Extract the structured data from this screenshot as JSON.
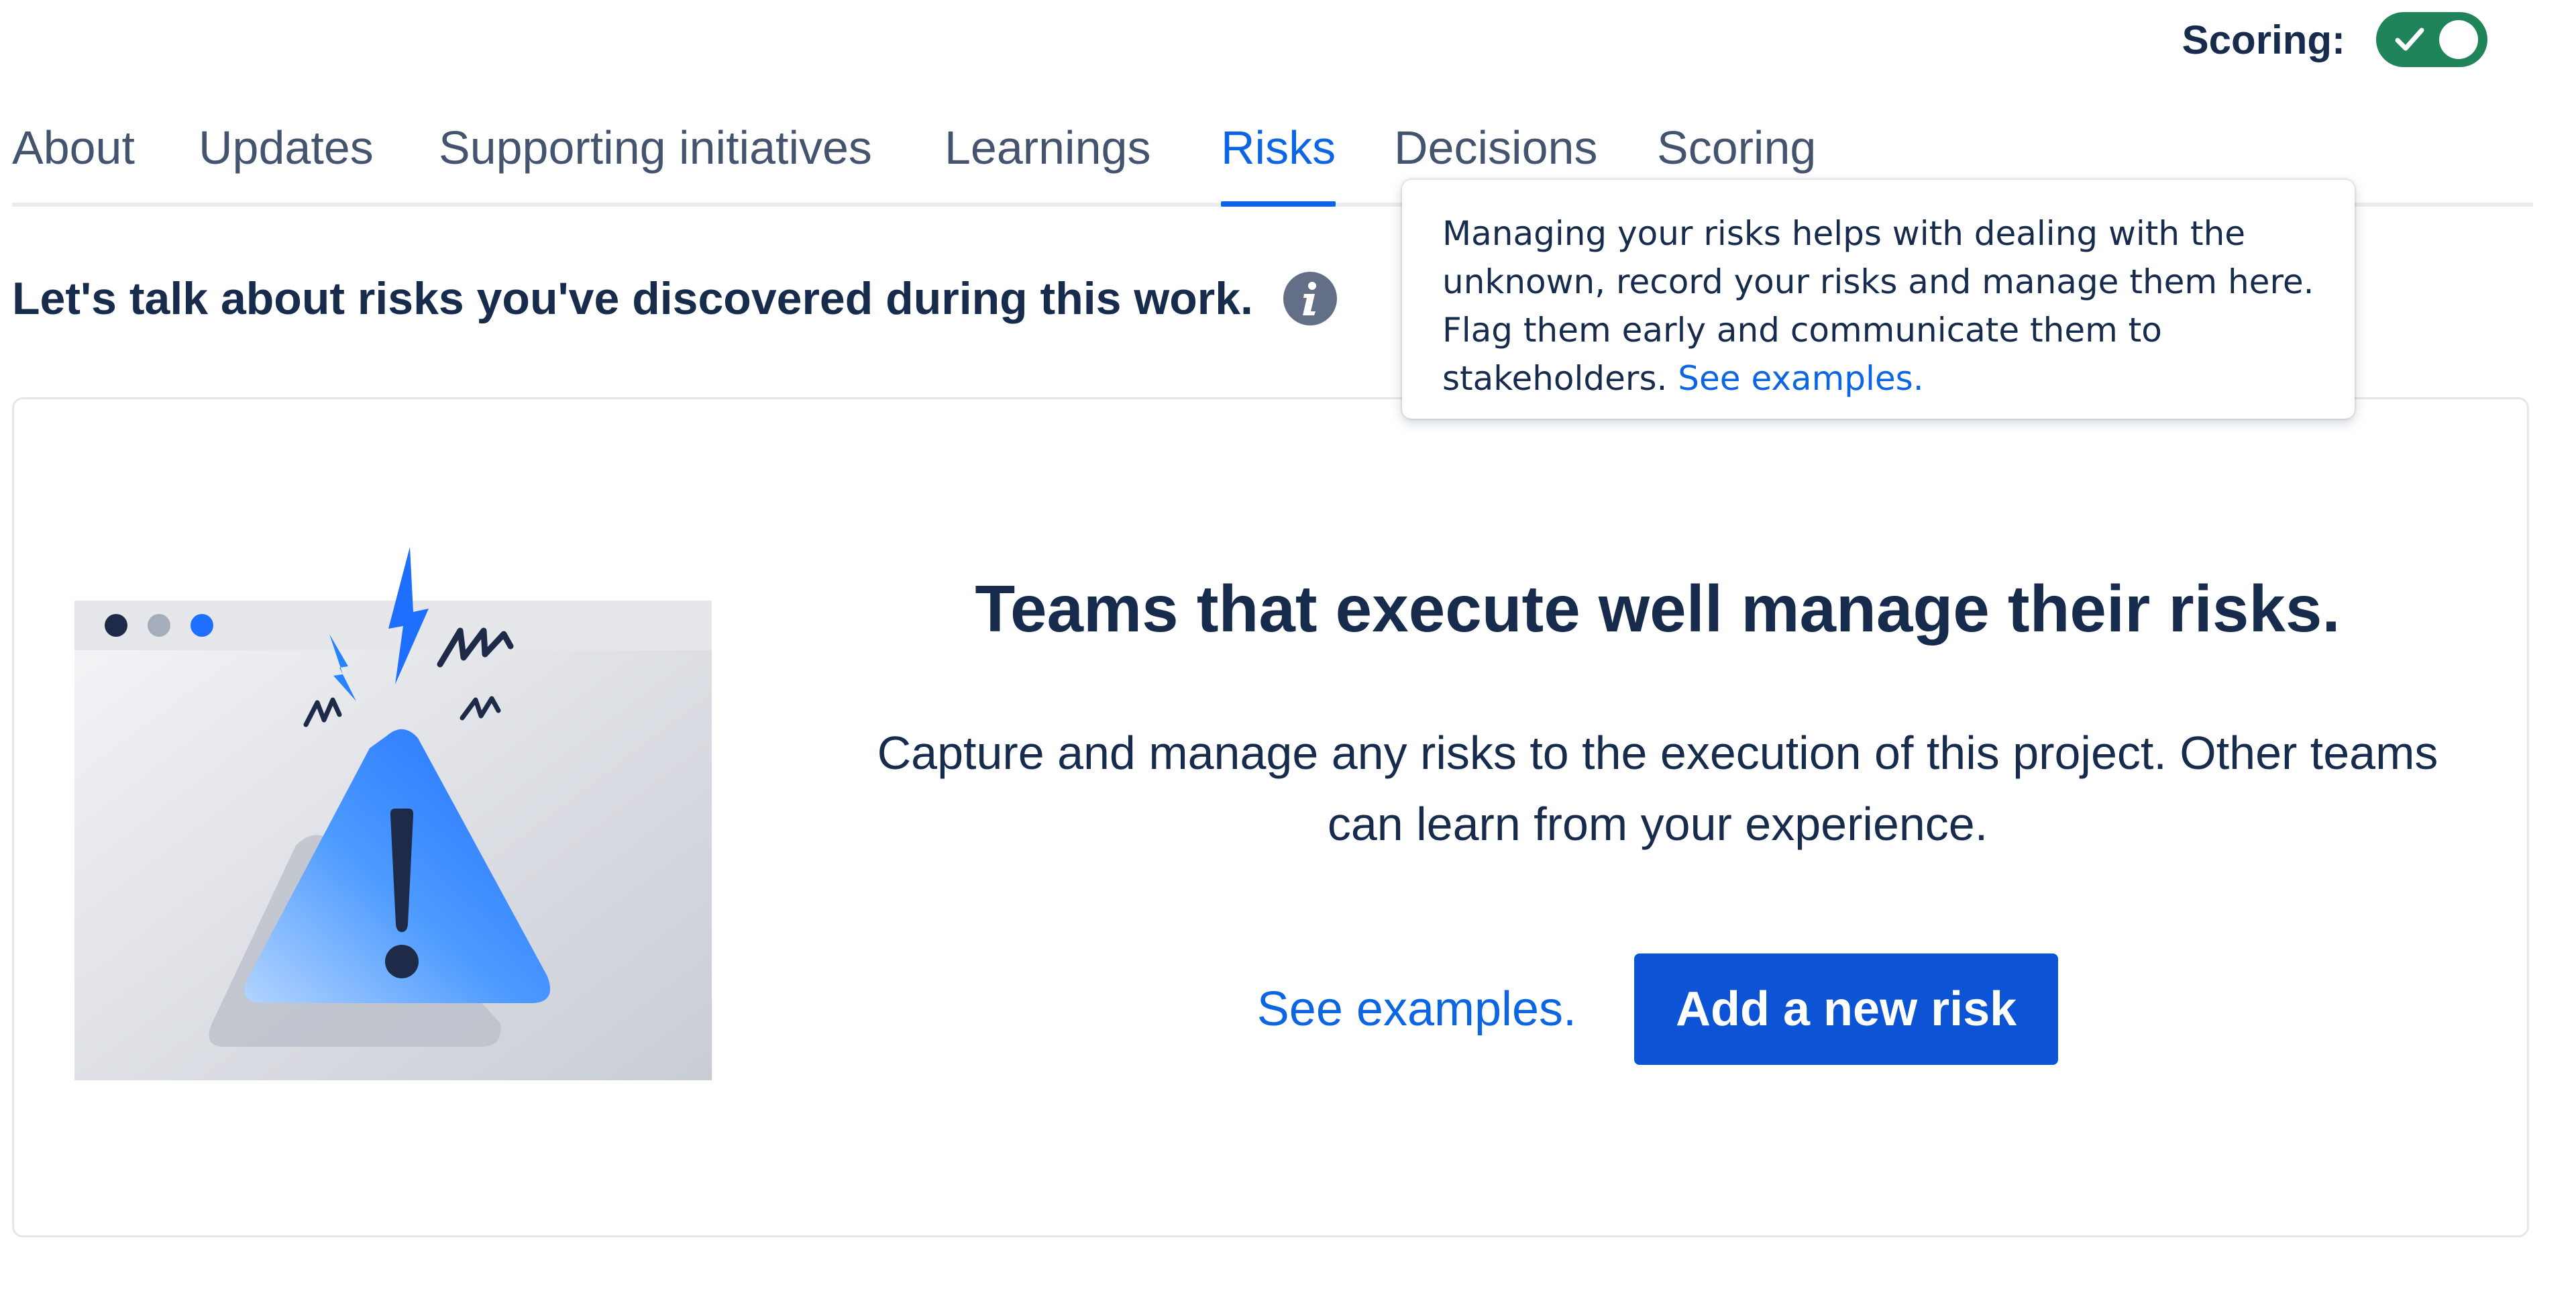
{
  "header": {
    "scoring_label": "Scoring:",
    "scoring_toggle_on": true
  },
  "tabs": [
    {
      "label": "About",
      "active": false
    },
    {
      "label": "Updates",
      "active": false
    },
    {
      "label": "Supporting initiatives",
      "active": false
    },
    {
      "label": "Learnings",
      "active": false
    },
    {
      "label": "Risks",
      "active": true
    },
    {
      "label": "Decisions",
      "active": false
    },
    {
      "label": "Scoring",
      "active": false
    }
  ],
  "intro": {
    "text": "Let's talk about risks you've discovered during this work.",
    "icon": "info-icon"
  },
  "tooltip": {
    "text": "Managing your risks helps with dealing with the unknown, record your risks and manage them here. Flag them early and communicate them to stakeholders.",
    "link": "See examples."
  },
  "empty_state": {
    "title": "Teams that execute well manage their risks.",
    "description": "Capture and manage any risks to the execution of this project. Other teams can learn from your experience.",
    "link_label": "See examples.",
    "button_label": "Add a new risk",
    "illustration": "warning-triangle-illustration"
  },
  "colors": {
    "accent": "#0c66e4",
    "button": "#0c53d6",
    "toggle_on": "#1f845a",
    "text": "#172b4d"
  }
}
